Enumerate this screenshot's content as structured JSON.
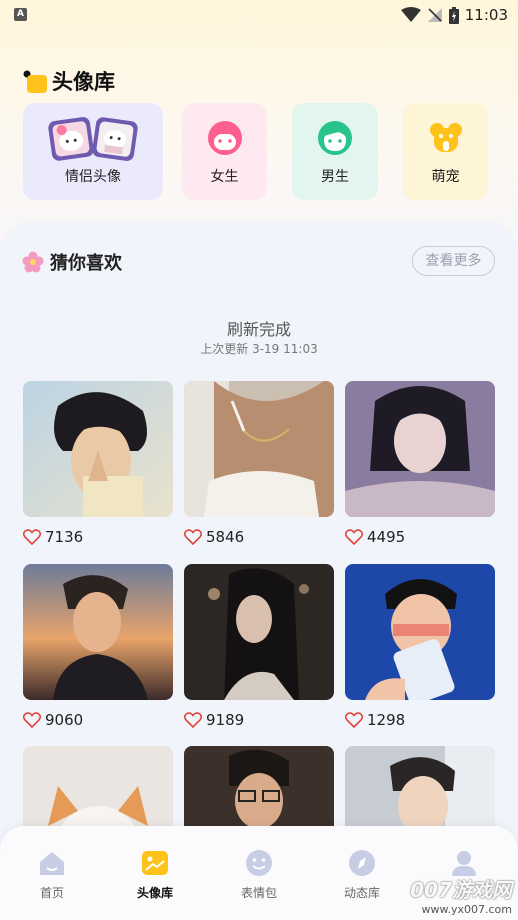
{
  "status_bar": {
    "left_badge": "A",
    "time": "11:03"
  },
  "header": {
    "title": "头像库"
  },
  "categories": [
    {
      "label": "情侣头像",
      "icon": "couple-avatar-icon",
      "bg": "#ebeafd"
    },
    {
      "label": "女生",
      "icon": "girl-face-icon",
      "bg": "#fde9ef"
    },
    {
      "label": "男生",
      "icon": "boy-face-icon",
      "bg": "#e2f6ef"
    },
    {
      "label": "萌宠",
      "icon": "pet-dog-icon",
      "bg": "#fef4d6"
    }
  ],
  "recommend": {
    "title": "猜你喜欢",
    "more_label": "查看更多",
    "refresh_title": "刷新完成",
    "refresh_subtitle": "上次更新 3-19 11:03"
  },
  "avatars": [
    {
      "likes": "7136"
    },
    {
      "likes": "5846"
    },
    {
      "likes": "4495"
    },
    {
      "likes": "9060"
    },
    {
      "likes": "9189"
    },
    {
      "likes": "1298"
    },
    {
      "likes": ""
    },
    {
      "likes": ""
    },
    {
      "likes": ""
    }
  ],
  "bottom_nav": [
    {
      "label": "首页",
      "icon": "home-icon"
    },
    {
      "label": "头像库",
      "icon": "image-library-icon",
      "active": true
    },
    {
      "label": "表情包",
      "icon": "emoji-icon"
    },
    {
      "label": "动态库",
      "icon": "compass-icon"
    },
    {
      "label": "",
      "icon": "profile-icon"
    }
  ],
  "watermark": {
    "big": "007游戏网",
    "small": "www.yx007.com"
  },
  "colors": {
    "accent_yellow": "#ffc21a",
    "heart": "#e0453a",
    "panel_bg": "#f2f4fc"
  }
}
